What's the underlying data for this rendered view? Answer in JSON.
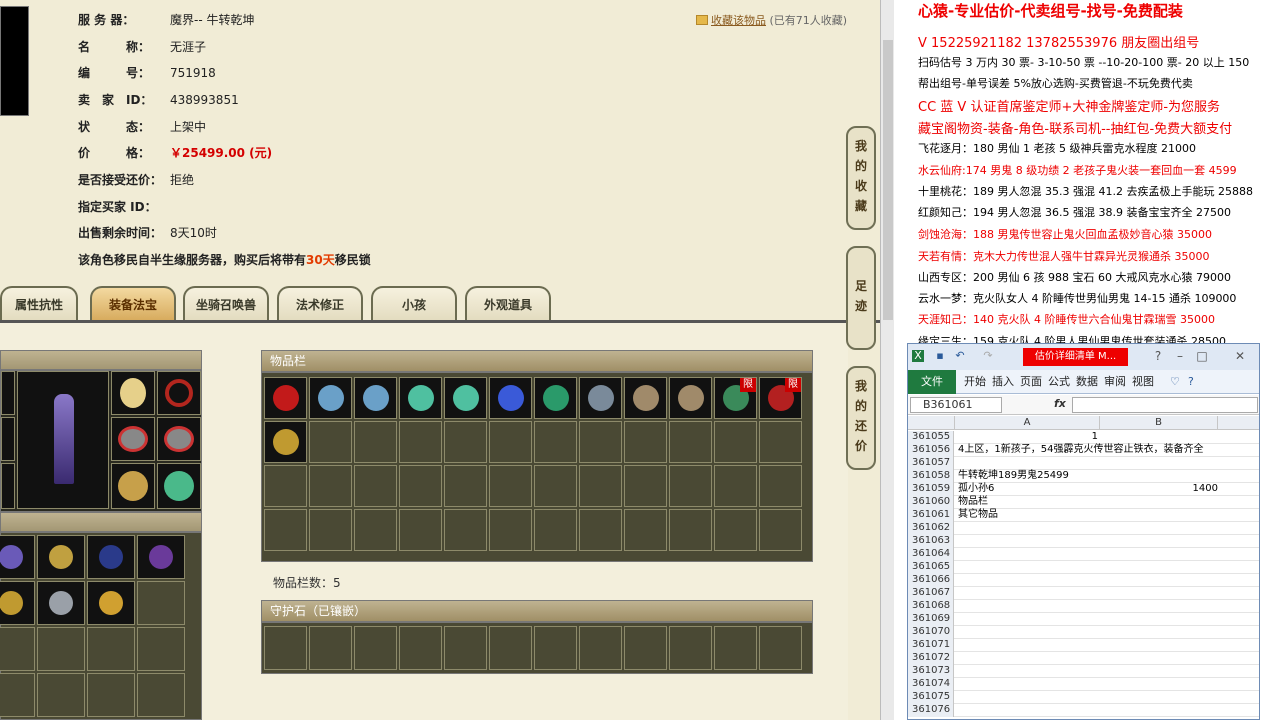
{
  "game": {
    "info": {
      "server_label": "服 务 器：",
      "server_value": "魔界-- 牛转乾坤",
      "name_label": "名　　　称：",
      "name_value": "无涯子",
      "id_label": "编　　　号：",
      "id_value": "751918",
      "seller_label": "卖　家　ID：",
      "seller_value": "438993851",
      "status_label": "状　　　态：",
      "status_value": "上架中",
      "price_label": "价　　　格：",
      "price_value": "￥25499.00 (元)",
      "bargain_label": "是否接受还价：",
      "bargain_value": "拒绝",
      "buyer_label": "指定买家 ID：",
      "buyer_value": "",
      "time_label": "出售剩余时间：",
      "time_value": "8天10时",
      "migrate_pre": "该角色移民自半生缘服务器，购买后将带有",
      "migrate_days": "30天",
      "migrate_post": "移民锁"
    },
    "fav": {
      "link": "收藏该物品",
      "count": "(已有71人收藏)"
    },
    "tabs": [
      "属性抗性",
      "装备法宝",
      "坐骑召唤兽",
      "法术修正",
      "小孩",
      "外观道具"
    ],
    "items_title": "物品栏",
    "items_count": "物品栏数：5",
    "guard_title": "守护石（已镶嵌）",
    "item_badges": [
      "限",
      "限"
    ],
    "sidenav": [
      "我的收藏",
      "足迹",
      "我的还价"
    ]
  },
  "doc": {
    "lines": [
      {
        "t": "心猿-专业估价-代卖组号-找号-免费配装",
        "c": "red",
        "s": "big"
      },
      {
        "t": "V 15225921182   13782553976 朋友圈出组号",
        "c": "red",
        "s": "mid"
      },
      {
        "t": "扫码估号 3 万内 30 票- 3-10-50 票  --10-20-100 票- 20 以上 150",
        "c": "black",
        "s": ""
      },
      {
        "t": "帮出组号-单号误差 5%放心选购-买费管退-不玩免费代卖",
        "c": "black",
        "s": ""
      },
      {
        "t": "CC 蓝 V 认证首席鉴定师+大神金牌鉴定师-为您服务",
        "c": "red",
        "s": "mid"
      },
      {
        "t": "藏宝阁物资-装备-角色-联系司机--抽红包-免费大额支付",
        "c": "red",
        "s": "mid"
      },
      {
        "t": "飞花逐月：180 男仙 1 老孩 5 级神兵雷克水程度 21000",
        "c": "black",
        "s": ""
      },
      {
        "t": "水云仙府:174 男鬼 8 级功绩 2 老孩子鬼火装一套回血一套 4599",
        "c": "red",
        "s": ""
      },
      {
        "t": "十里桃花：189 男人忽混 35.3 强混 41.2 去疾孟极上手能玩 25888",
        "c": "black",
        "s": ""
      },
      {
        "t": "红颜知己：194 男人忽混 36.5 强混 38.9 装备宝宝齐全 27500",
        "c": "black",
        "s": ""
      },
      {
        "t": "剑蚀沧海：188 男鬼传世容止鬼火回血孟极妙音心猿 35000",
        "c": "red",
        "s": ""
      },
      {
        "t": "天若有情：克木大力传世混人强牛甘霖异光灵猴通杀 35000",
        "c": "red",
        "s": ""
      },
      {
        "t": "山西专区：200 男仙 6 孩 988 宝石 60 大戒风克水心猿 79000",
        "c": "black",
        "s": ""
      },
      {
        "t": "云水一梦：克火队女人 4 阶睡传世男仙男鬼 14-15 通杀 109000",
        "c": "black",
        "s": ""
      },
      {
        "t": "天涯知己：140 克火队 4 阶睡传世六合仙鬼甘霖瑞雪 35000",
        "c": "red",
        "s": ""
      },
      {
        "t": "缘定三生：159 克火队 4 阶男人男仙男鬼传世套装通杀 28500",
        "c": "black",
        "s": ""
      }
    ]
  },
  "excel": {
    "title": "估价详细清单 M...",
    "tabs": [
      "文件",
      "开始",
      "插入",
      "页面",
      "公式",
      "数据",
      "审阅",
      "视图"
    ],
    "namebox": "B361061",
    "fx": "fx",
    "col_a": "A",
    "col_b": "B",
    "rows": [
      {
        "n": "361055",
        "a": "",
        "b": "1",
        "bpos": "a"
      },
      {
        "n": "361056",
        "a": "4上区，1新孩子，54强霹克火传世容止铁衣，装备齐全",
        "b": ""
      },
      {
        "n": "361057",
        "a": "",
        "b": ""
      },
      {
        "n": "361058",
        "a": "牛转乾坤189男鬼25499",
        "b": ""
      },
      {
        "n": "361059",
        "a": "孤小孙6",
        "b": "1400"
      },
      {
        "n": "361060",
        "a": "物品栏",
        "b": ""
      },
      {
        "n": "361061",
        "a": "其它物品",
        "b": ""
      },
      {
        "n": "361062",
        "a": "",
        "b": ""
      },
      {
        "n": "361063",
        "a": "",
        "b": ""
      },
      {
        "n": "361064",
        "a": "",
        "b": ""
      },
      {
        "n": "361065",
        "a": "",
        "b": ""
      },
      {
        "n": "361066",
        "a": "",
        "b": ""
      },
      {
        "n": "361067",
        "a": "",
        "b": ""
      },
      {
        "n": "361068",
        "a": "",
        "b": ""
      },
      {
        "n": "361069",
        "a": "",
        "b": ""
      },
      {
        "n": "361070",
        "a": "",
        "b": ""
      },
      {
        "n": "361071",
        "a": "",
        "b": ""
      },
      {
        "n": "361072",
        "a": "",
        "b": ""
      },
      {
        "n": "361073",
        "a": "",
        "b": ""
      },
      {
        "n": "361074",
        "a": "",
        "b": ""
      },
      {
        "n": "361075",
        "a": "",
        "b": ""
      },
      {
        "n": "361076",
        "a": "",
        "b": ""
      }
    ]
  },
  "colors": {
    "price": "#d40000",
    "doc_red": "#ee0000",
    "excel_green": "#1f7a3f"
  }
}
